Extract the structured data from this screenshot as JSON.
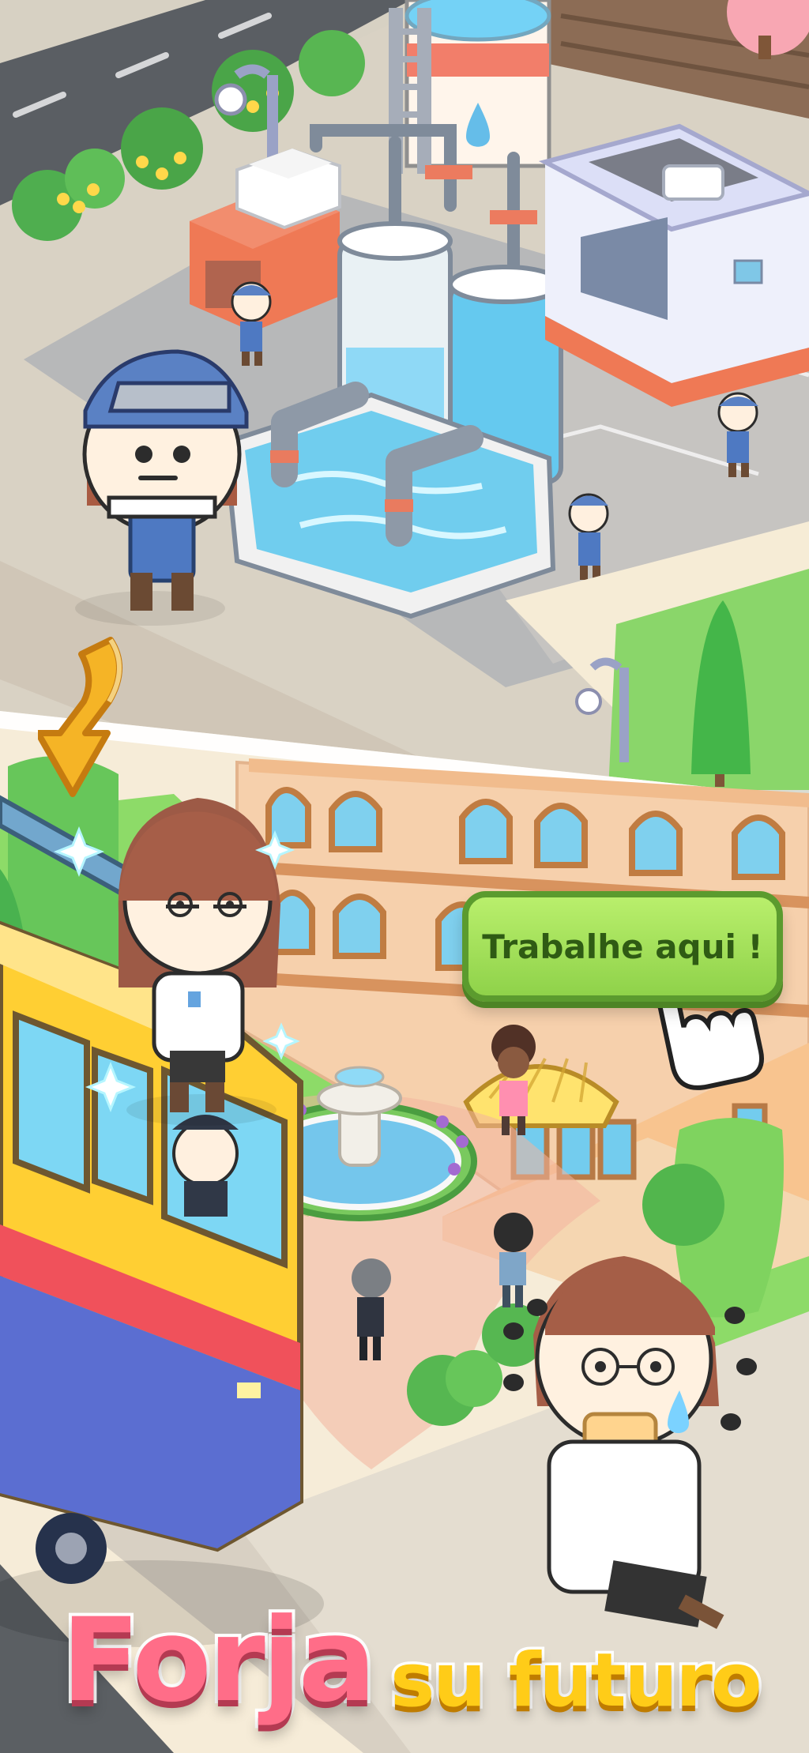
{
  "speech_bubble": {
    "text": "Trabalhe aqui !"
  },
  "title": {
    "part1": "Forja",
    "part2": "su futuro"
  },
  "colors": {
    "road": "#5a5e63",
    "pavement": "#ded6c8",
    "grass": "#79cf58",
    "water": "#65c9ef",
    "bubble_green": "#9ddd55",
    "title_pink": "#ff6d88",
    "title_yellow": "#ffcc18",
    "bus_yellow": "#ffcf33",
    "arrow_orange": "#f5b426"
  },
  "icons": [
    "water-drop-icon",
    "down-arrow-icon",
    "tap-hand-icon",
    "sparkle-icon",
    "sweat-drop-icon"
  ]
}
